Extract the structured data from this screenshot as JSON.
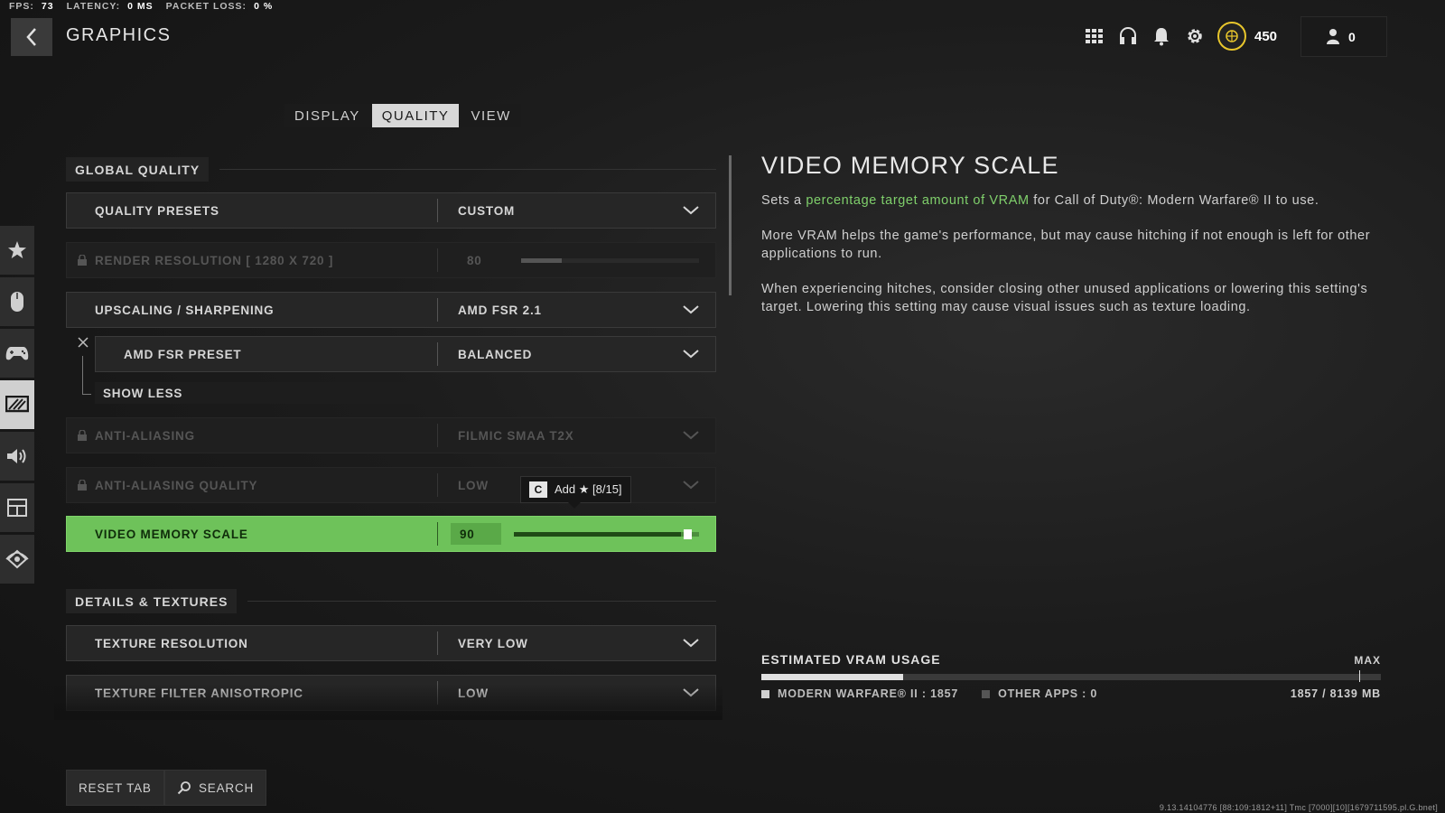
{
  "stats": {
    "fps_label": "FPS:",
    "fps_value": "73",
    "latency_label": "LATENCY:",
    "latency_value": "0 MS",
    "packet_label": "PACKET LOSS:",
    "packet_value": "0 %"
  },
  "header": {
    "title": "GRAPHICS"
  },
  "top_bar": {
    "icons": [
      "grid-icon",
      "headset-icon",
      "bell-icon",
      "gear-icon",
      "cod-points-icon"
    ],
    "cod_points": "450",
    "friends_online": "0",
    "accent_color": "#e8c62c"
  },
  "tabs": [
    {
      "label": "DISPLAY",
      "active": false
    },
    {
      "label": "QUALITY",
      "active": true
    },
    {
      "label": "VIEW",
      "active": false
    }
  ],
  "sidebar": {
    "items": [
      {
        "icon": "star-icon",
        "active": false
      },
      {
        "icon": "mouse-icon",
        "active": false
      },
      {
        "icon": "controller-icon",
        "active": false
      },
      {
        "icon": "graphics-icon",
        "active": true
      },
      {
        "icon": "speaker-icon",
        "active": false
      },
      {
        "icon": "interface-icon",
        "active": false
      },
      {
        "icon": "account-icon",
        "active": false
      }
    ]
  },
  "sections": {
    "global_quality": "GLOBAL QUALITY",
    "details_textures": "DETAILS & TEXTURES"
  },
  "settings": {
    "quality_presets": {
      "label": "QUALITY PRESETS",
      "value": "CUSTOM"
    },
    "render_resolution": {
      "label": "RENDER RESOLUTION [ 1280 X 720 ]",
      "value": "80",
      "level": 0.23
    },
    "upscaling": {
      "label": "UPSCALING / SHARPENING",
      "value": "AMD FSR 2.1"
    },
    "fsr_preset": {
      "label": "AMD FSR PRESET",
      "value": "BALANCED"
    },
    "show_less": "SHOW LESS",
    "anti_aliasing": {
      "label": "ANTI-ALIASING",
      "value": "FILMIC SMAA T2X"
    },
    "anti_aliasing_quality": {
      "label": "ANTI-ALIASING QUALITY",
      "value": "LOW"
    },
    "video_memory_scale": {
      "label": "VIDEO MEMORY SCALE",
      "value": "90",
      "level": 0.9
    },
    "texture_resolution": {
      "label": "TEXTURE RESOLUTION",
      "value": "VERY LOW"
    },
    "texture_filter": {
      "label": "TEXTURE FILTER ANISOTROPIC",
      "value": "LOW"
    }
  },
  "tooltip": {
    "key": "C",
    "text": "Add ★ [8/15]"
  },
  "description": {
    "title": "VIDEO MEMORY SCALE",
    "p1_before": "Sets a ",
    "p1_highlight": "percentage target amount of VRAM",
    "p1_after": " for  Call of Duty®: Modern Warfare® II to use.",
    "p2": "More VRAM helps the game's performance, but may cause hitching if not enough is left for other applications to run.",
    "p3": "When experiencing hitches, consider closing other unused applications or lowering this setting's target. Lowering this setting may cause visual issues such as texture loading.",
    "highlight_color": "#7fcf6b"
  },
  "vram": {
    "title": "ESTIMATED VRAM USAGE",
    "max_label": "MAX",
    "mw2_label": "MODERN WARFARE® II : 1857",
    "other_label": "OTHER APPS : 0",
    "total_label": "1857 / 8139 MB",
    "used_mb": 1857,
    "total_mb": 8139
  },
  "bottom": {
    "reset_label": "RESET TAB",
    "search_label": "SEARCH"
  },
  "version": "9.13.14104776 [88:109:1812+11] Tmc [7000][10][1679711595.pl.G.bnet]",
  "colors": {
    "active_green": "#6ec25a",
    "background": "#1c1c1c"
  }
}
